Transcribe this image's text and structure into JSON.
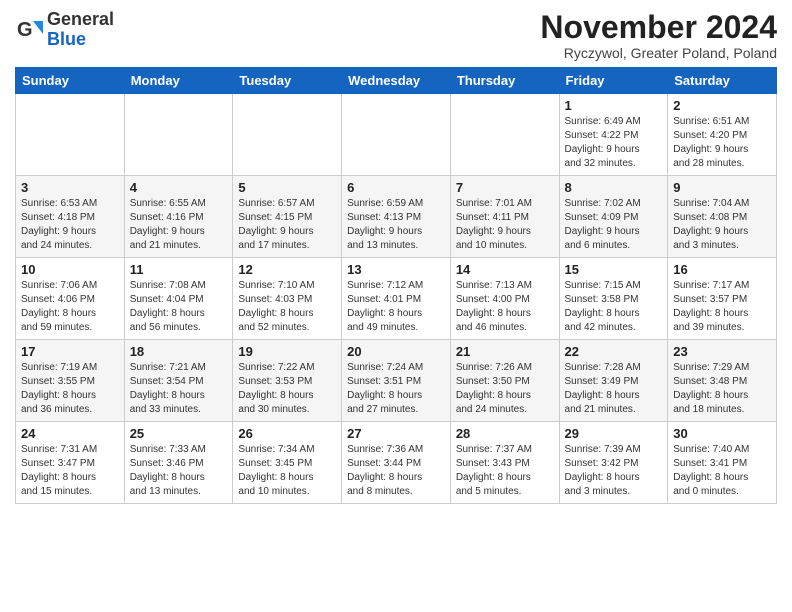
{
  "header": {
    "logo_line1": "General",
    "logo_line2": "Blue",
    "title": "November 2024",
    "location": "Ryczywol, Greater Poland, Poland"
  },
  "weekdays": [
    "Sunday",
    "Monday",
    "Tuesday",
    "Wednesday",
    "Thursday",
    "Friday",
    "Saturday"
  ],
  "weeks": [
    [
      {
        "day": "",
        "info": ""
      },
      {
        "day": "",
        "info": ""
      },
      {
        "day": "",
        "info": ""
      },
      {
        "day": "",
        "info": ""
      },
      {
        "day": "",
        "info": ""
      },
      {
        "day": "1",
        "info": "Sunrise: 6:49 AM\nSunset: 4:22 PM\nDaylight: 9 hours\nand 32 minutes."
      },
      {
        "day": "2",
        "info": "Sunrise: 6:51 AM\nSunset: 4:20 PM\nDaylight: 9 hours\nand 28 minutes."
      }
    ],
    [
      {
        "day": "3",
        "info": "Sunrise: 6:53 AM\nSunset: 4:18 PM\nDaylight: 9 hours\nand 24 minutes."
      },
      {
        "day": "4",
        "info": "Sunrise: 6:55 AM\nSunset: 4:16 PM\nDaylight: 9 hours\nand 21 minutes."
      },
      {
        "day": "5",
        "info": "Sunrise: 6:57 AM\nSunset: 4:15 PM\nDaylight: 9 hours\nand 17 minutes."
      },
      {
        "day": "6",
        "info": "Sunrise: 6:59 AM\nSunset: 4:13 PM\nDaylight: 9 hours\nand 13 minutes."
      },
      {
        "day": "7",
        "info": "Sunrise: 7:01 AM\nSunset: 4:11 PM\nDaylight: 9 hours\nand 10 minutes."
      },
      {
        "day": "8",
        "info": "Sunrise: 7:02 AM\nSunset: 4:09 PM\nDaylight: 9 hours\nand 6 minutes."
      },
      {
        "day": "9",
        "info": "Sunrise: 7:04 AM\nSunset: 4:08 PM\nDaylight: 9 hours\nand 3 minutes."
      }
    ],
    [
      {
        "day": "10",
        "info": "Sunrise: 7:06 AM\nSunset: 4:06 PM\nDaylight: 8 hours\nand 59 minutes."
      },
      {
        "day": "11",
        "info": "Sunrise: 7:08 AM\nSunset: 4:04 PM\nDaylight: 8 hours\nand 56 minutes."
      },
      {
        "day": "12",
        "info": "Sunrise: 7:10 AM\nSunset: 4:03 PM\nDaylight: 8 hours\nand 52 minutes."
      },
      {
        "day": "13",
        "info": "Sunrise: 7:12 AM\nSunset: 4:01 PM\nDaylight: 8 hours\nand 49 minutes."
      },
      {
        "day": "14",
        "info": "Sunrise: 7:13 AM\nSunset: 4:00 PM\nDaylight: 8 hours\nand 46 minutes."
      },
      {
        "day": "15",
        "info": "Sunrise: 7:15 AM\nSunset: 3:58 PM\nDaylight: 8 hours\nand 42 minutes."
      },
      {
        "day": "16",
        "info": "Sunrise: 7:17 AM\nSunset: 3:57 PM\nDaylight: 8 hours\nand 39 minutes."
      }
    ],
    [
      {
        "day": "17",
        "info": "Sunrise: 7:19 AM\nSunset: 3:55 PM\nDaylight: 8 hours\nand 36 minutes."
      },
      {
        "day": "18",
        "info": "Sunrise: 7:21 AM\nSunset: 3:54 PM\nDaylight: 8 hours\nand 33 minutes."
      },
      {
        "day": "19",
        "info": "Sunrise: 7:22 AM\nSunset: 3:53 PM\nDaylight: 8 hours\nand 30 minutes."
      },
      {
        "day": "20",
        "info": "Sunrise: 7:24 AM\nSunset: 3:51 PM\nDaylight: 8 hours\nand 27 minutes."
      },
      {
        "day": "21",
        "info": "Sunrise: 7:26 AM\nSunset: 3:50 PM\nDaylight: 8 hours\nand 24 minutes."
      },
      {
        "day": "22",
        "info": "Sunrise: 7:28 AM\nSunset: 3:49 PM\nDaylight: 8 hours\nand 21 minutes."
      },
      {
        "day": "23",
        "info": "Sunrise: 7:29 AM\nSunset: 3:48 PM\nDaylight: 8 hours\nand 18 minutes."
      }
    ],
    [
      {
        "day": "24",
        "info": "Sunrise: 7:31 AM\nSunset: 3:47 PM\nDaylight: 8 hours\nand 15 minutes."
      },
      {
        "day": "25",
        "info": "Sunrise: 7:33 AM\nSunset: 3:46 PM\nDaylight: 8 hours\nand 13 minutes."
      },
      {
        "day": "26",
        "info": "Sunrise: 7:34 AM\nSunset: 3:45 PM\nDaylight: 8 hours\nand 10 minutes."
      },
      {
        "day": "27",
        "info": "Sunrise: 7:36 AM\nSunset: 3:44 PM\nDaylight: 8 hours\nand 8 minutes."
      },
      {
        "day": "28",
        "info": "Sunrise: 7:37 AM\nSunset: 3:43 PM\nDaylight: 8 hours\nand 5 minutes."
      },
      {
        "day": "29",
        "info": "Sunrise: 7:39 AM\nSunset: 3:42 PM\nDaylight: 8 hours\nand 3 minutes."
      },
      {
        "day": "30",
        "info": "Sunrise: 7:40 AM\nSunset: 3:41 PM\nDaylight: 8 hours\nand 0 minutes."
      }
    ]
  ]
}
